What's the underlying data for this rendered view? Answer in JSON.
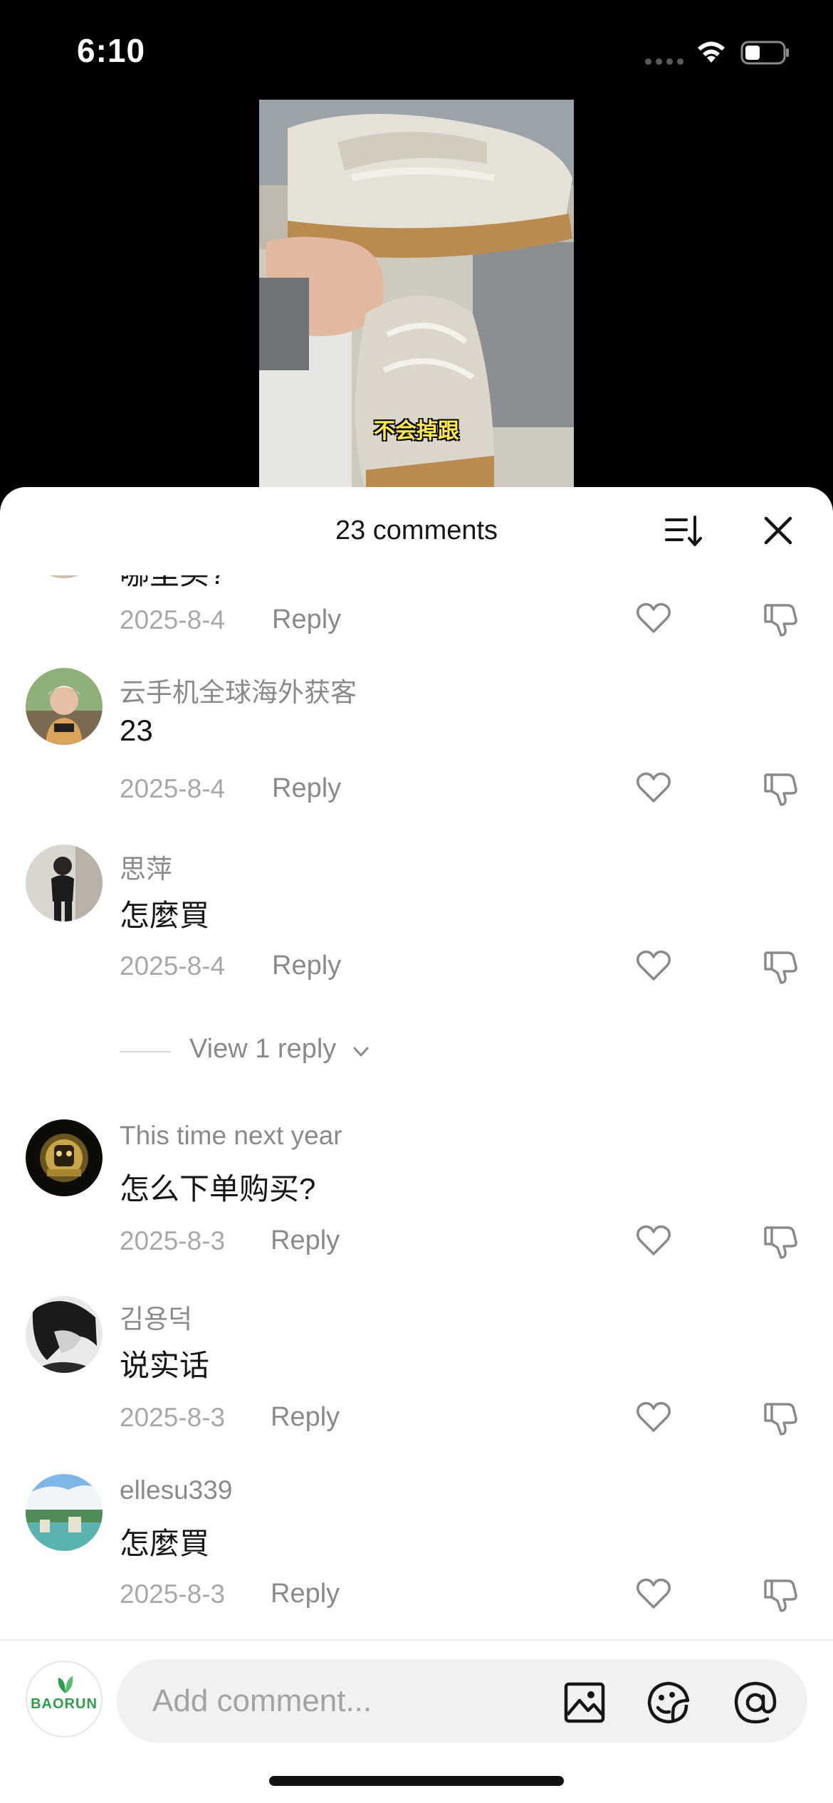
{
  "status_bar": {
    "time": "6:10",
    "icons": [
      "cellular-dots-icon",
      "wifi-icon",
      "battery-icon"
    ]
  },
  "video": {
    "subtitle": "不会掉跟"
  },
  "sheet": {
    "title": "23 comments",
    "icons": [
      "sort-icon",
      "close-icon"
    ]
  },
  "comments": [
    {
      "username": "",
      "text": "哪里买?",
      "date": "2025-8-4",
      "reply": "Reply"
    },
    {
      "username": "云手机全球海外获客",
      "text": "23",
      "date": "2025-8-4",
      "reply": "Reply"
    },
    {
      "username": "思萍",
      "text": "怎麼買",
      "date": "2025-8-4",
      "reply": "Reply",
      "view_replies": "View 1 reply"
    },
    {
      "username": "This time next year",
      "text": "怎么下单购买?",
      "date": "2025-8-3",
      "reply": "Reply"
    },
    {
      "username": "김용덕",
      "text": "说实话",
      "date": "2025-8-3",
      "reply": "Reply"
    },
    {
      "username": "ellesu339",
      "text": "怎麼買",
      "date": "2025-8-3",
      "reply": "Reply"
    }
  ],
  "composer": {
    "avatar_logo": "BAORUN",
    "placeholder": "Add comment...",
    "icons": [
      "image-icon",
      "sticker-icon",
      "mention-icon"
    ]
  },
  "colors": {
    "text_primary": "#161616",
    "text_secondary": "#8a8a8a",
    "text_muted": "#a8a8a8",
    "input_bg": "#f1f1f2",
    "logo_green": "#2e9e4a"
  }
}
